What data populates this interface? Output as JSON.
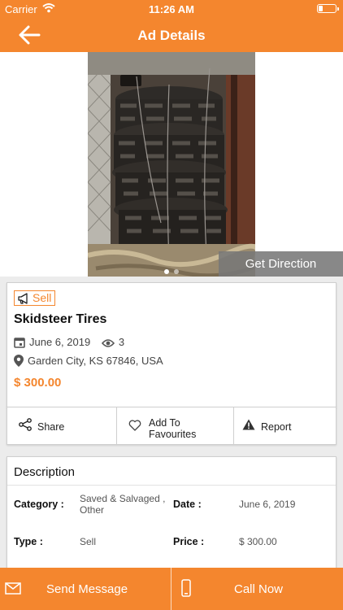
{
  "status_bar": {
    "carrier": "Carrier",
    "time": "11:26 AM",
    "battery_level": 0.2
  },
  "nav": {
    "title": "Ad Details",
    "back_icon": "arrow-left-icon"
  },
  "gallery": {
    "dot_count": 2,
    "active_dot": 1,
    "get_direction": "Get Direction"
  },
  "ad": {
    "type_badge": "Sell",
    "title": "Skidsteer Tires",
    "date": "June 6, 2019",
    "views": "3",
    "location": "Garden City, KS 67846, USA",
    "price": "$ 300.00"
  },
  "actions": {
    "share": "Share",
    "favourite_line1": "Add To",
    "favourite_line2": "Favourites",
    "report": "Report"
  },
  "description": {
    "title": "Description",
    "category_label": "Category :",
    "category_line1": "Saved & Salvaged ,",
    "category_line2": "Other",
    "date_label": "Date :",
    "date_value": "June 6, 2019",
    "type_label": "Type :",
    "type_value": "Sell",
    "price_label": "Price :",
    "price_value": "$ 300.00"
  },
  "bottom": {
    "send_message": "Send Message",
    "call_now": "Call Now"
  },
  "colors": {
    "accent": "#f4862e",
    "background": "#ececec"
  }
}
